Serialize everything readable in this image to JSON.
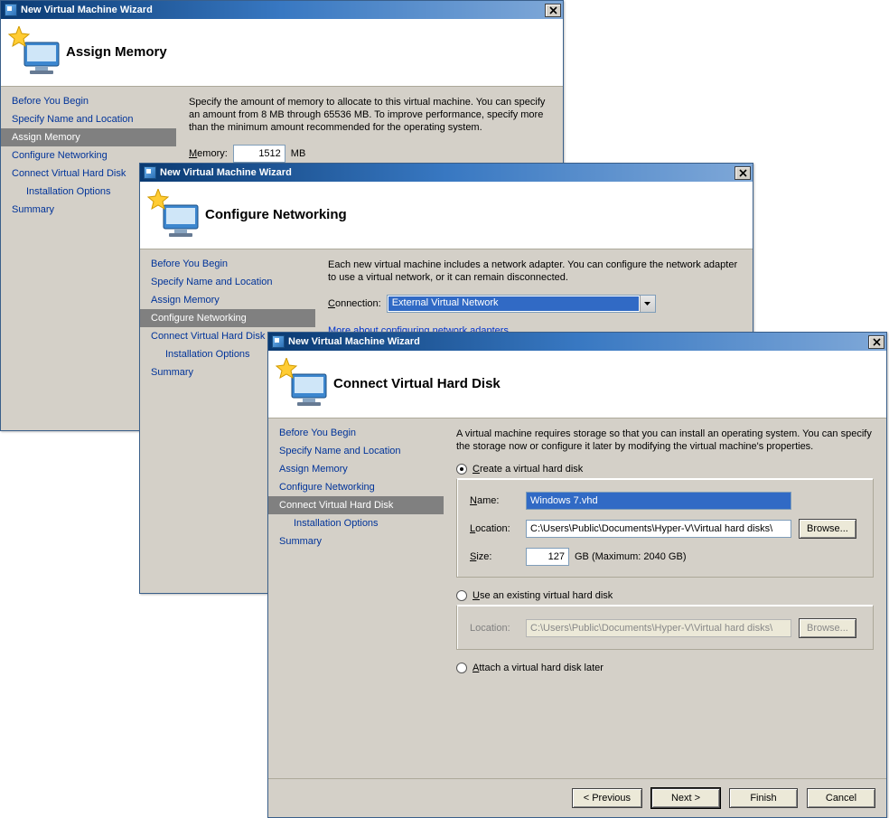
{
  "wizard_title": "New Virtual Machine Wizard",
  "steps": [
    "Before You Begin",
    "Specify Name and Location",
    "Assign Memory",
    "Configure Networking",
    "Connect Virtual Hard Disk",
    "Installation Options",
    "Summary"
  ],
  "buttons": {
    "previous": "< Previous",
    "next": "Next >",
    "finish": "Finish",
    "cancel": "Cancel",
    "browse": "Browse..."
  },
  "win1": {
    "header": "Assign Memory",
    "active_step_index": 2,
    "desc": "Specify the amount of memory to allocate to this virtual machine. You can specify an amount from 8 MB through 65536 MB. To improve performance, specify more than the minimum amount recommended for the operating system.",
    "memory_label": "Memory:",
    "memory_value": "1512",
    "memory_unit": "MB"
  },
  "win2": {
    "header": "Configure Networking",
    "active_step_index": 3,
    "desc": "Each new virtual machine includes a network adapter. You can configure the network adapter to use a virtual network, or it can remain disconnected.",
    "connection_label": "Connection:",
    "connection_value": "External Virtual Network",
    "link_text": "More about configuring network adapters"
  },
  "win3": {
    "header": "Connect Virtual Hard Disk",
    "active_step_index": 4,
    "desc": "A virtual machine requires storage so that you can install an operating system. You can specify the storage now or configure it later by modifying the virtual machine's properties.",
    "options": {
      "create": "Create a virtual hard disk",
      "existing": "Use an existing virtual hard disk",
      "later": "Attach a virtual hard disk later"
    },
    "selected_option": "create",
    "create": {
      "name_label": "Name:",
      "name_value": "Windows 7.vhd",
      "location_label": "Location:",
      "location_value": "C:\\Users\\Public\\Documents\\Hyper-V\\Virtual hard disks\\",
      "size_label": "Size:",
      "size_value": "127",
      "size_unit": "GB (Maximum: 2040 GB)"
    },
    "existing": {
      "location_label": "Location:",
      "location_value": "C:\\Users\\Public\\Documents\\Hyper-V\\Virtual hard disks\\"
    }
  }
}
